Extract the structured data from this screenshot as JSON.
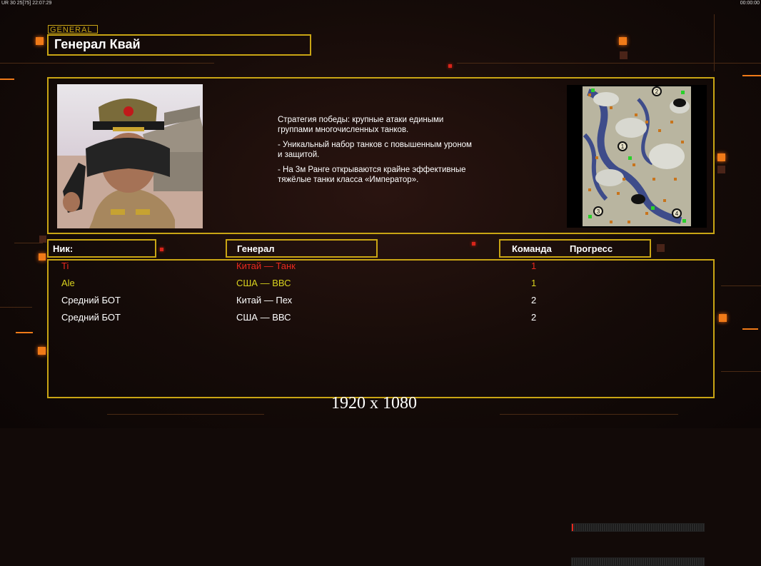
{
  "topbar": {
    "left_status": "UR 30 25[75] 22:07:29",
    "right_time": "00:00:00"
  },
  "header": {
    "tag": "GENERAL",
    "title": "Генерал Квай"
  },
  "description": {
    "lines": [
      "Стратегия победы: крупные атаки едиными\n группами многочисленных танков.",
      "- Уникальный набор танков с повышенным уроном\n и защитой.",
      "- На 3м Ранге открываются крайне эффективные\n тяжёлые танки класса «Император»."
    ]
  },
  "map": {
    "spawn_labels": [
      "1",
      "2",
      "3",
      "4"
    ]
  },
  "columns": {
    "nick": "Ник:",
    "general": "Генерал",
    "team": "Команда",
    "progress": "Прогресс"
  },
  "players": [
    {
      "nick": "Ti",
      "general": "Китай — Танк",
      "team": "1",
      "color": "#e8281e",
      "progress": 0.01
    },
    {
      "nick": "Ale",
      "general": "США — ВВС",
      "team": "1",
      "color": "#d9d21e",
      "progress": 0
    },
    {
      "nick": "Средний БОТ",
      "general": "Китай — Пех",
      "team": "2",
      "color": "#ffffff"
    },
    {
      "nick": "Средний БОТ",
      "general": "США — ВВС",
      "team": "2",
      "color": "#ffffff"
    }
  ],
  "footer": {
    "resolution": "1920 x 1080"
  },
  "colors": {
    "frame": "#c9a514",
    "accent": "#f07a18"
  }
}
